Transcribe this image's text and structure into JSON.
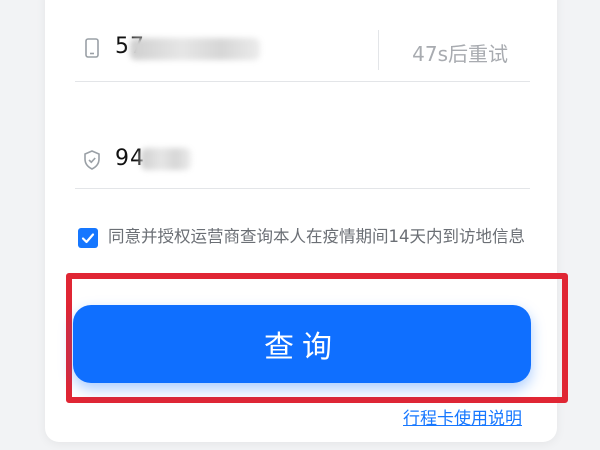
{
  "phone": {
    "icon": "phone-icon",
    "value_visible": "57",
    "resend_label": "47s后重试"
  },
  "code": {
    "icon": "shield-check-icon",
    "value_visible": "94"
  },
  "agreement": {
    "checked": true,
    "text": "同意并授权运营商查询本人在疫情期间14天内到访地信息"
  },
  "query_button": {
    "label": "查询"
  },
  "help_link": {
    "label": "行程卡使用说明"
  },
  "colors": {
    "accent": "#0f6fff",
    "highlight_border": "#e02634",
    "placeholder_text": "#a8abb0"
  }
}
